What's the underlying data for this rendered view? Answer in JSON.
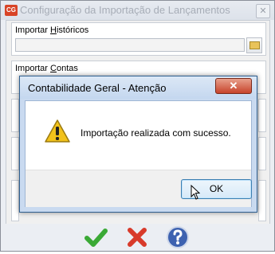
{
  "window": {
    "icon_text": "CG",
    "title": "Configuração da Importação de Lançamentos",
    "close_symbol": "✕"
  },
  "sections": {
    "importar_historicos": {
      "label_pre": "Importar ",
      "label_u": "H",
      "label_post": "istóricos",
      "value": ""
    },
    "importar_contas": {
      "label_pre": "Importar ",
      "label_u": "C",
      "label_post": "ontas"
    }
  },
  "toolbar": {
    "confirm_icon": "check-icon",
    "cancel_icon": "cross-icon",
    "help_icon": "help-icon",
    "colors": {
      "confirm": "#3aa935",
      "cancel": "#d83a2a",
      "help": "#3d62b0"
    }
  },
  "dialog": {
    "title": "Contabilidade Geral - Atenção",
    "close_symbol": "✕",
    "message": "Importação realizada com sucesso.",
    "ok_label": "OK",
    "icon": "warning-icon"
  }
}
